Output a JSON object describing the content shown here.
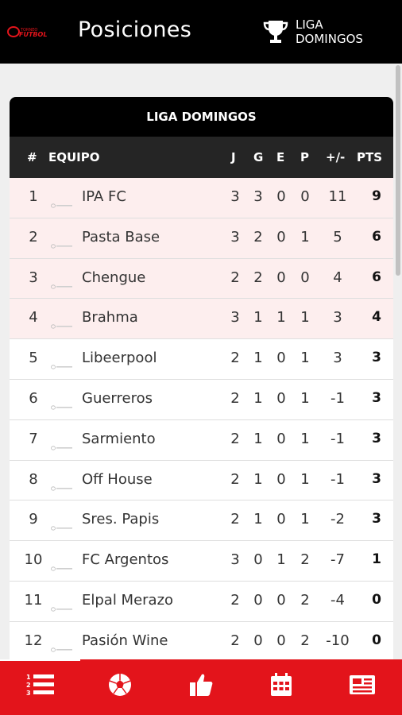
{
  "header": {
    "app_logo": "futbol-logo",
    "title": "Posiciones",
    "league_icon": "trophy-icon",
    "league_line1": "LIGA",
    "league_line2": "DOMINGOS"
  },
  "table": {
    "title": "LIGA DOMINGOS",
    "columns": {
      "pos": "#",
      "team": "EQUIPO",
      "j": "J",
      "g": "G",
      "e": "E",
      "p": "P",
      "diff": "+/-",
      "pts": "PTS"
    },
    "rows": [
      {
        "pos": "1",
        "team": "IPA FC",
        "j": "3",
        "g": "3",
        "e": "0",
        "p": "0",
        "diff": "11",
        "pts": "9",
        "highlight": true
      },
      {
        "pos": "2",
        "team": "Pasta Base",
        "j": "3",
        "g": "2",
        "e": "0",
        "p": "1",
        "diff": "5",
        "pts": "6",
        "highlight": true
      },
      {
        "pos": "3",
        "team": "Chengue",
        "j": "2",
        "g": "2",
        "e": "0",
        "p": "0",
        "diff": "4",
        "pts": "6",
        "highlight": true
      },
      {
        "pos": "4",
        "team": "Brahma",
        "j": "3",
        "g": "1",
        "e": "1",
        "p": "1",
        "diff": "3",
        "pts": "4",
        "highlight": true
      },
      {
        "pos": "5",
        "team": "Libeerpool",
        "j": "2",
        "g": "1",
        "e": "0",
        "p": "1",
        "diff": "3",
        "pts": "3",
        "highlight": false
      },
      {
        "pos": "6",
        "team": "Guerreros",
        "j": "2",
        "g": "1",
        "e": "0",
        "p": "1",
        "diff": "-1",
        "pts": "3",
        "highlight": false
      },
      {
        "pos": "7",
        "team": "Sarmiento",
        "j": "2",
        "g": "1",
        "e": "0",
        "p": "1",
        "diff": "-1",
        "pts": "3",
        "highlight": false
      },
      {
        "pos": "8",
        "team": "Off House",
        "j": "2",
        "g": "1",
        "e": "0",
        "p": "1",
        "diff": "-1",
        "pts": "3",
        "highlight": false
      },
      {
        "pos": "9",
        "team": "Sres. Papis",
        "j": "2",
        "g": "1",
        "e": "0",
        "p": "1",
        "diff": "-2",
        "pts": "3",
        "highlight": false
      },
      {
        "pos": "10",
        "team": "FC Argentos",
        "j": "3",
        "g": "0",
        "e": "1",
        "p": "2",
        "diff": "-7",
        "pts": "1",
        "highlight": false
      },
      {
        "pos": "11",
        "team": "Elpal Merazo",
        "j": "2",
        "g": "0",
        "e": "0",
        "p": "2",
        "diff": "-4",
        "pts": "0",
        "highlight": false
      },
      {
        "pos": "12",
        "team": "Pasión Wine",
        "j": "2",
        "g": "0",
        "e": "0",
        "p": "2",
        "diff": "-10",
        "pts": "0",
        "highlight": false
      }
    ]
  },
  "nav": {
    "tabs": [
      {
        "icon": "standings-list-icon",
        "active": true
      },
      {
        "icon": "soccer-ball-icon",
        "active": false
      },
      {
        "icon": "thumbs-up-icon",
        "active": false
      },
      {
        "icon": "calendar-icon",
        "active": false
      },
      {
        "icon": "news-icon",
        "active": false
      }
    ]
  },
  "colors": {
    "header_bg": "#000000",
    "accent_red": "#e3141b",
    "highlight_row": "#fdeeee"
  }
}
